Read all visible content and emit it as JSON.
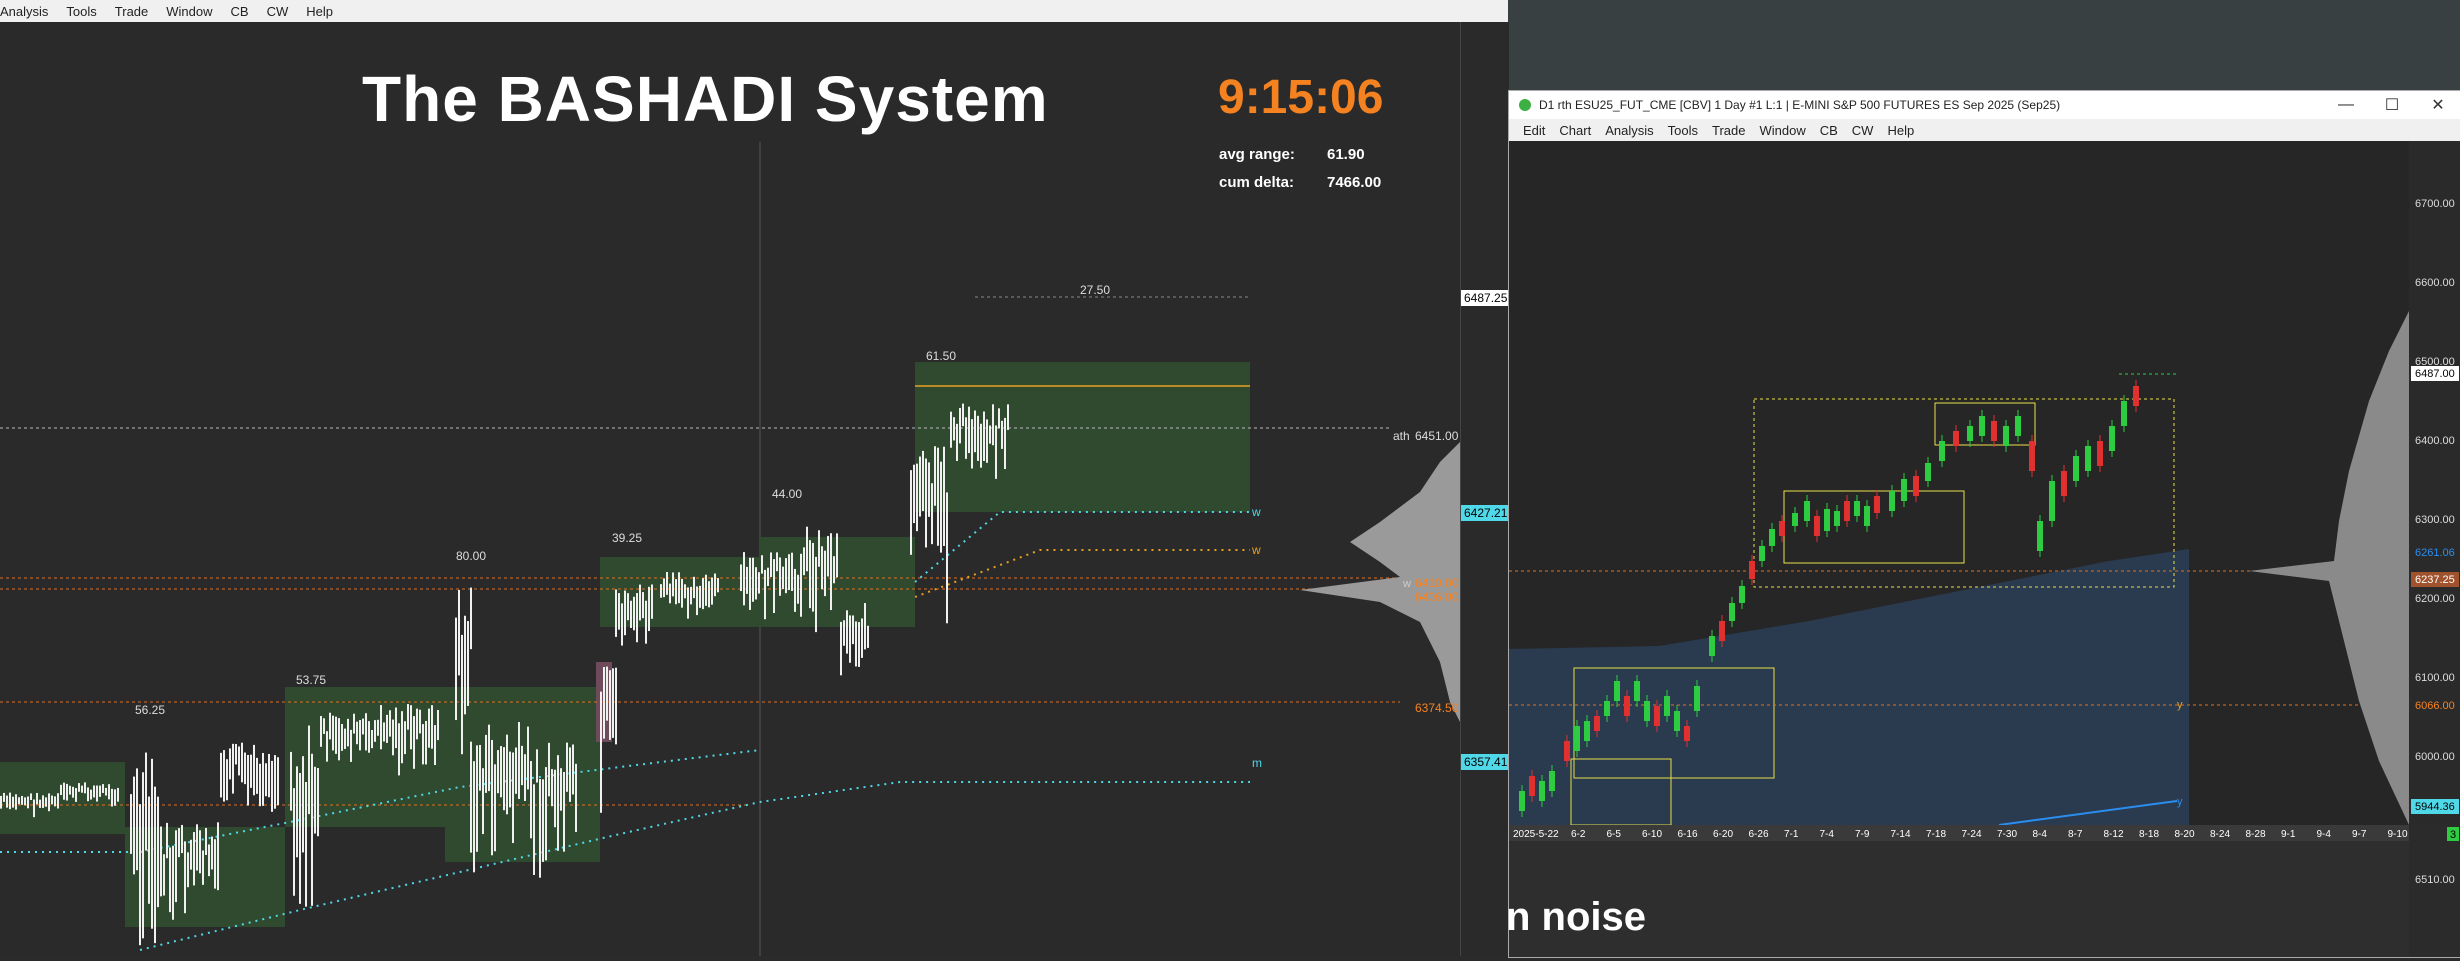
{
  "main_menu": [
    "Analysis",
    "Tools",
    "Trade",
    "Window",
    "CB",
    "CW",
    "Help"
  ],
  "overlay": {
    "title": "The BASHADI System",
    "clock": "9:15:06",
    "avg_range_label": "avg range:",
    "avg_range_value": "61.90",
    "cum_delta_label": "cum delta:",
    "cum_delta_value": "7466.00"
  },
  "left_chart": {
    "range_labels": [
      {
        "text": "56.25"
      },
      {
        "text": "53.75"
      },
      {
        "text": "80.00"
      },
      {
        "text": "39.25"
      },
      {
        "text": "44.00"
      },
      {
        "text": "61.50"
      },
      {
        "text": "27.50"
      }
    ],
    "ath_label": "ath",
    "ath_price": "6451.00",
    "level_6410": "6410.00",
    "level_6406": "6406.00",
    "level_6374": "6374.50",
    "w_label": "w",
    "m_label": "m",
    "axis_boxes": [
      "6487.25",
      "6427.21",
      "6357.41"
    ]
  },
  "window": {
    "title": "D1 rth ESU25_FUT_CME [CBV]  1 Day  #1 L:1 | E-MINI S&P 500 FUTURES ES Sep 2025 (Sep25)",
    "menu": [
      "Edit",
      "Chart",
      "Analysis",
      "Tools",
      "Trade",
      "Window",
      "CB",
      "CW",
      "Help"
    ],
    "minimize": "—",
    "maximize": "☐",
    "close": "✕"
  },
  "daily_chart": {
    "price_axis": [
      "6700.00",
      "6600.00",
      "6500.00",
      "6400.00",
      "6300.00",
      "6200.00",
      "6100.00",
      "6000.00",
      "6510.00"
    ],
    "price_boxes": {
      "top": "6487.00",
      "blue": "6261.06",
      "orange_a": "6237.25",
      "orange_b": "6066.00",
      "cyan": "5944.36",
      "green": "3"
    },
    "dates": [
      "2025-5-22",
      "6-2",
      "6-5",
      "6-10",
      "6-16",
      "6-20",
      "6-26",
      "7-1",
      "7-4",
      "7-9",
      "7-14",
      "7-18",
      "7-24",
      "7-30",
      "8-4",
      "8-7",
      "8-12",
      "8-18",
      "8-20",
      "8-24",
      "8-28",
      "9-1",
      "9-4",
      "9-7",
      "9-10"
    ],
    "y_label": "y"
  },
  "caption_fragment": "n noise",
  "colors": {
    "orange": "#f58220",
    "cyan": "#4fd8e8",
    "green_box": "#2f4a2f",
    "yellow": "#e8e04a",
    "up": "#2ecc40",
    "down": "#e03030"
  }
}
